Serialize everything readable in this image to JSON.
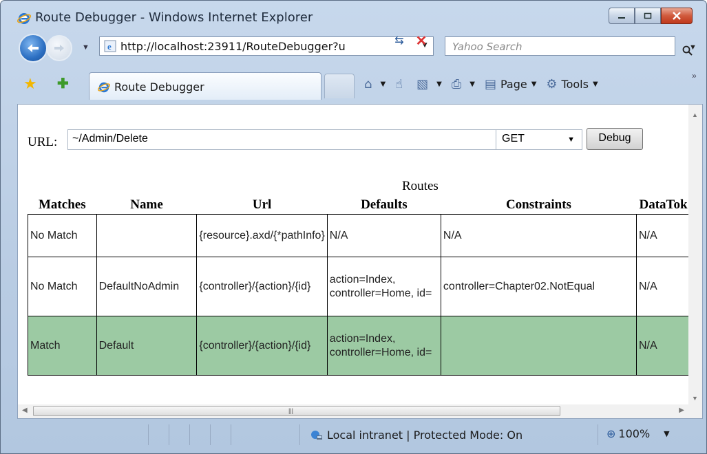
{
  "window": {
    "title": "Route Debugger - Windows Internet Explorer"
  },
  "nav": {
    "address": "http://localhost:23911/RouteDebugger?u",
    "search_placeholder": "Yahoo Search"
  },
  "tabs": {
    "active_label": "Route Debugger"
  },
  "commandbar": {
    "page_label": "Page",
    "tools_label": "Tools"
  },
  "form": {
    "url_label": "URL:",
    "url_value": "~/Admin/Delete",
    "method": "GET",
    "debug_label": "Debug"
  },
  "routes": {
    "caption": "Routes",
    "headers": [
      "Matches",
      "Name",
      "Url",
      "Defaults",
      "Constraints",
      "DataTok"
    ],
    "rows": [
      {
        "matches": "No Match",
        "name": "",
        "url": "{resource}.axd/{*pathInfo}",
        "defaults": "N/A",
        "constraints": "N/A",
        "datatokens": "N/A"
      },
      {
        "matches": "No Match",
        "name": "DefaultNoAdmin",
        "url": "{controller}/{action}/{id}",
        "defaults": "action=Index, controller=Home, id=",
        "constraints": "controller=Chapter02.NotEqual",
        "datatokens": "N/A"
      },
      {
        "matches": "Match",
        "name": "Default",
        "url": "{controller}/{action}/{id}",
        "defaults": "action=Index, controller=Home, id=",
        "constraints": "",
        "datatokens": "N/A"
      }
    ]
  },
  "statusbar": {
    "zone": "Local intranet | Protected Mode: On",
    "zoom": "100%"
  },
  "colors": {
    "match_row": "#9ccaa3",
    "chrome": "#c7d8ec"
  }
}
